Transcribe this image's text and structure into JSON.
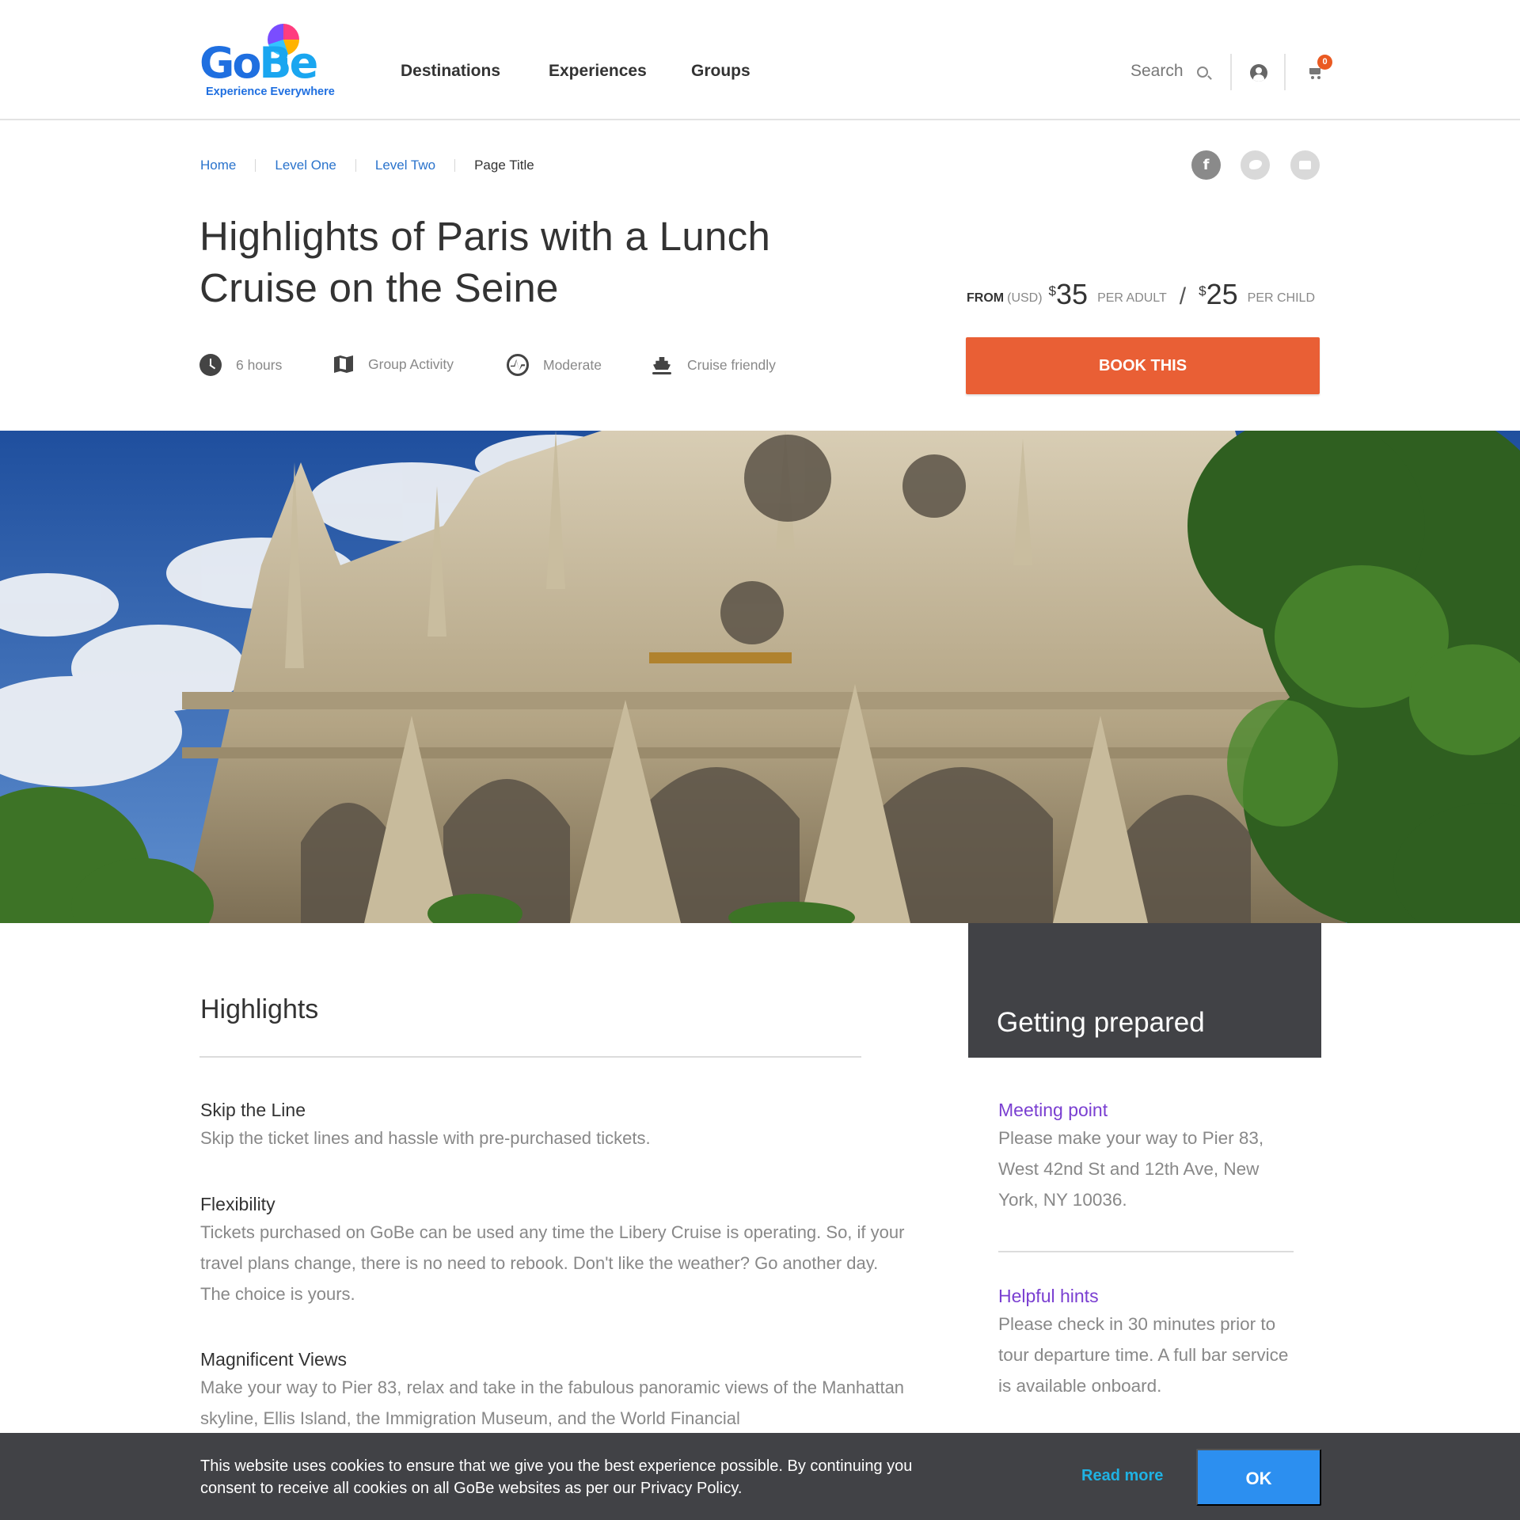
{
  "header": {
    "logo": {
      "word_go": "Go",
      "word_be": "Be",
      "tagline": "Experience Everywhere"
    },
    "nav": [
      "Destinations",
      "Experiences",
      "Groups"
    ],
    "search_label": "Search",
    "cart_count": "0"
  },
  "breadcrumb": [
    "Home",
    "Level One",
    "Level Two",
    "Page Title"
  ],
  "social": {
    "facebook_glyph": "f",
    "icons": [
      "facebook-icon",
      "twitter-icon",
      "email-icon"
    ]
  },
  "title": "Highlights of Paris with a Lunch Cruise on the Seine",
  "facts": [
    {
      "icon": "clock-icon",
      "label": "6 hours"
    },
    {
      "icon": "map-icon",
      "label": "Group Activity"
    },
    {
      "icon": "pulse-icon",
      "label": "Moderate"
    },
    {
      "icon": "ship-icon",
      "label": "Cruise friendly"
    }
  ],
  "pricing": {
    "from": "FROM",
    "currency": "(USD)",
    "currency_symbol": "$",
    "adult_amount": "35",
    "adult_unit": "PER ADULT",
    "separator": "/",
    "child_amount": "25",
    "child_unit": "PER CHILD"
  },
  "book_button": "BOOK THIS",
  "highlights": {
    "title": "Highlights",
    "items": [
      {
        "heading": "Skip the Line",
        "text": "Skip the ticket lines and hassle with pre-purchased tickets."
      },
      {
        "heading": "Flexibility",
        "text": "Tickets purchased on GoBe can be used any time the Libery Cruise is operating. So, if your travel plans change, there is no need to rebook. Don't like the weather? Go another day. The choice is yours."
      },
      {
        "heading": "Magnificent Views",
        "text": "Make your way to Pier 83, relax and take in the fabulous panoramic views of the Manhattan skyline, Ellis Island, the Immigration Museum, and the World Financial"
      }
    ]
  },
  "getting_prepared": {
    "title": "Getting prepared",
    "items": [
      {
        "heading": "Meeting point",
        "text": "Please make your way to Pier 83, West 42nd St and 12th Ave, New York, NY 10036."
      },
      {
        "heading": "Helpful hints",
        "text": "Please check in 30 minutes prior to tour departure time. A full bar service is available onboard."
      }
    ]
  },
  "cookie_bar": {
    "text": "This website uses cookies to ensure that we give you the best experience possible. By continuing you consent to receive all cookies on all GoBe websites as per our Privacy Policy.",
    "read_more": "Read more",
    "ok": "OK"
  },
  "colors": {
    "accent_orange": "#e95f35",
    "link_blue": "#2a73cc",
    "hint_purple": "#7a3fd1",
    "dark_panel": "#414246",
    "ok_blue": "#2c8ff0",
    "read_more_cyan": "#1fb2e3"
  }
}
